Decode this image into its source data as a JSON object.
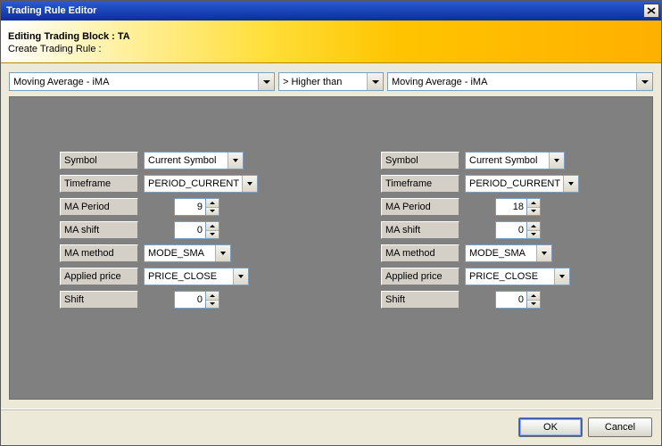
{
  "window": {
    "title": "Trading Rule Editor"
  },
  "header": {
    "line1": "Editing Trading Block : TA",
    "line2": "Create Trading Rule :"
  },
  "top_row": {
    "left_indicator": "Moving Average - iMA",
    "comparator": "> Higher than",
    "right_indicator": "Moving Average - iMA"
  },
  "params": {
    "labels": {
      "symbol": "Symbol",
      "timeframe": "Timeframe",
      "ma_period": "MA Period",
      "ma_shift": "MA shift",
      "ma_method": "MA method",
      "applied_price": "Applied price",
      "shift": "Shift"
    },
    "left": {
      "symbol": "Current Symbol",
      "timeframe": "PERIOD_CURRENT",
      "ma_period": "9",
      "ma_shift": "0",
      "ma_method": "MODE_SMA",
      "applied_price": "PRICE_CLOSE",
      "shift": "0"
    },
    "right": {
      "symbol": "Current Symbol",
      "timeframe": "PERIOD_CURRENT",
      "ma_period": "18",
      "ma_shift": "0",
      "ma_method": "MODE_SMA",
      "applied_price": "PRICE_CLOSE",
      "shift": "0"
    }
  },
  "footer": {
    "ok": "OK",
    "cancel": "Cancel"
  }
}
